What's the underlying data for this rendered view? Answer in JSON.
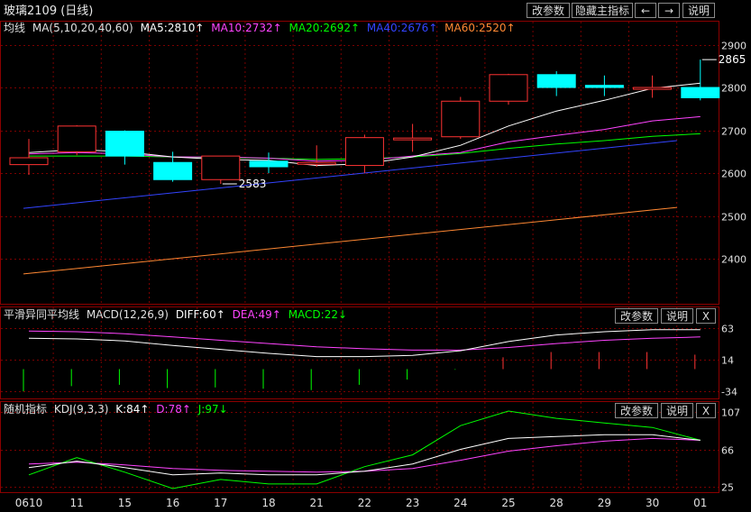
{
  "title": "玻璃2109 (日线)",
  "toolbar": {
    "param_label": "改参数",
    "hide_label": "隐藏主指标",
    "prev_icon": "←",
    "next_icon": "→",
    "help_label": "说明",
    "close_label": "X"
  },
  "colors": {
    "up": "#ff3333",
    "down": "#00ffff",
    "ma5": "#ffffff",
    "ma10": "#ff44ff",
    "ma20": "#00ff00",
    "ma40": "#3344ff",
    "ma60": "#ff8833",
    "grid": "#7a0000"
  },
  "chart_data": [
    {
      "type": "candlestick",
      "dates": [
        "0610",
        "11",
        "15",
        "16",
        "17",
        "18",
        "21",
        "22",
        "23",
        "24",
        "25",
        "28",
        "29",
        "30",
        "01"
      ],
      "ohlc": [
        [
          2620,
          2680,
          2596,
          2636
        ],
        [
          2650,
          2712,
          2642,
          2710
        ],
        [
          2698,
          2700,
          2620,
          2640
        ],
        [
          2625,
          2650,
          2580,
          2585
        ],
        [
          2585,
          2640,
          2575,
          2640
        ],
        [
          2628,
          2648,
          2600,
          2615
        ],
        [
          2625,
          2665,
          2615,
          2625
        ],
        [
          2618,
          2690,
          2600,
          2683
        ],
        [
          2678,
          2715,
          2650,
          2682
        ],
        [
          2685,
          2778,
          2680,
          2768
        ],
        [
          2768,
          2832,
          2760,
          2830
        ],
        [
          2830,
          2838,
          2780,
          2800
        ],
        [
          2805,
          2828,
          2780,
          2800
        ],
        [
          2800,
          2828,
          2776,
          2800
        ],
        [
          2800,
          2865,
          2770,
          2776
        ]
      ],
      "indicator_label": "均线",
      "ma_labels": {
        "params": "MA(5,10,20,40,60)",
        "ma5": "MA5:2810↑",
        "ma10": "MA10:2732↑",
        "ma20": "MA20:2692↑",
        "ma40": "MA40:2676↑",
        "ma60": "MA60:2520↑"
      },
      "ma": {
        "ma5": [
          2648,
          2655,
          2650,
          2638,
          2632,
          2630,
          2618,
          2622,
          2638,
          2665,
          2710,
          2745,
          2770,
          2798,
          2810
        ],
        "ma10": [
          2645,
          2648,
          2645,
          2638,
          2638,
          2635,
          2628,
          2630,
          2640,
          2648,
          2673,
          2688,
          2702,
          2722,
          2732
        ],
        "ma20": [
          2640,
          2640,
          2640,
          2638,
          2636,
          2635,
          2632,
          2634,
          2638,
          2646,
          2658,
          2668,
          2676,
          2686,
          2692
        ],
        "ma40": [
          2518,
          2531,
          2542,
          2553,
          2564,
          2575,
          2584,
          2594,
          2606,
          2618,
          2630,
          2642,
          2654,
          2666,
          2676
        ]
      },
      "ma60_line": {
        "x": [
          0,
          14
        ],
        "y": [
          2365,
          2520
        ]
      },
      "y_ticks": [
        2400,
        2500,
        2600,
        2700,
        2800,
        2900
      ],
      "ylim": [
        2310,
        2920
      ],
      "annotations": [
        {
          "text": "2583",
          "x": 4,
          "y": 2575
        },
        {
          "text": "2865",
          "x": 14,
          "y": 2865
        }
      ]
    },
    {
      "type": "line",
      "title": "平滑异同平均线",
      "params": "MACD(12,26,9)",
      "labels": {
        "diff": "DIFF:60↑",
        "dea": "DEA:49↑",
        "macd": "MACD:22↓"
      },
      "diff": [
        47,
        46,
        43,
        36,
        30,
        24,
        19,
        19,
        21,
        28,
        42,
        52,
        57,
        60,
        60
      ],
      "dea": [
        58,
        57,
        54,
        49,
        44,
        39,
        34,
        31,
        29,
        29,
        33,
        39,
        44,
        47,
        49
      ],
      "macd": [
        -34,
        -26,
        -24,
        -29,
        -28,
        -30,
        -32,
        -24,
        -16,
        -1,
        18,
        26,
        26,
        26,
        22
      ],
      "y_ticks": [
        -34,
        14,
        63
      ],
      "ylim": [
        -42,
        68
      ]
    },
    {
      "type": "line",
      "title": "随机指标",
      "params": "KDJ(9,3,3)",
      "labels": {
        "k": "K:84↑",
        "d": "D:78↑",
        "j": "J:97↓"
      },
      "k": [
        46,
        53,
        46,
        38,
        40,
        38,
        38,
        42,
        50,
        66,
        78,
        80,
        82,
        82,
        76
      ],
      "d": [
        50,
        52,
        49,
        45,
        43,
        42,
        41,
        42,
        45,
        54,
        64,
        70,
        75,
        78,
        76
      ],
      "j": [
        38,
        57,
        41,
        23,
        33,
        28,
        28,
        47,
        60,
        92,
        108,
        100,
        95,
        90,
        76
      ],
      "y_ticks": [
        25,
        66,
        107
      ],
      "ylim": [
        20,
        112
      ]
    }
  ]
}
